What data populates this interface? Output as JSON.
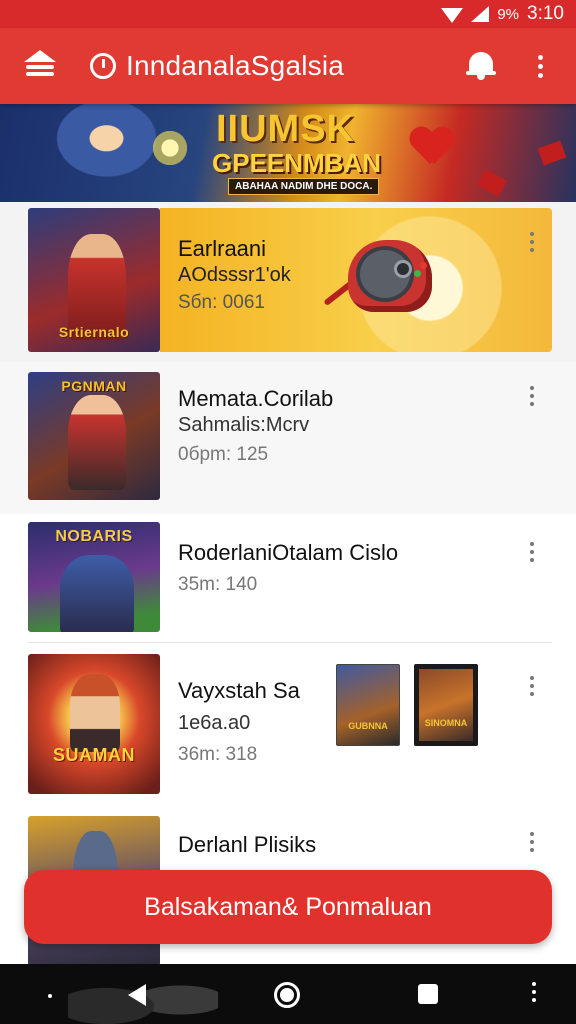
{
  "status_bar": {
    "battery": "9%",
    "time": "3:10"
  },
  "app_bar": {
    "title": "InndanalaSgalsia"
  },
  "banner": {
    "title": "IIUMSK",
    "subtitle": "GPEENMBAN",
    "tagline": "ABAHAA NADIM DHE DOCA."
  },
  "items": [
    {
      "title": "Earlraani",
      "subtitle": "AOdsssr1'ok",
      "meta": "Sбn: 0061",
      "thumb_logo": "Srtiernalo"
    },
    {
      "title": "Memata.Corilab",
      "subtitle": "Sahmalis:Mcrv",
      "meta": "0бpm: 125",
      "thumb_logo": "PGNMAN"
    },
    {
      "title": "RoderlaniOtalam Cislo",
      "meta": "35m: 140",
      "thumb_logo": "NOBARIS"
    },
    {
      "title": "Vayxstah Sa",
      "subtitle": "1e6a.a0",
      "meta": "36m: 318",
      "thumb_logo": "SUAMAN",
      "mini_labels": [
        "GUBNNA",
        "SINOMNA"
      ]
    },
    {
      "title": "Derlanl Plisiks"
    }
  ],
  "cta": {
    "label": "Balsakaman& Ponmaluan"
  },
  "colors": {
    "primary": "#e03a33",
    "status_bar": "#d92a2b",
    "cta": "#e0312d",
    "nav": "#0c0c0c"
  },
  "icons": [
    "wifi-icon",
    "signal-icon",
    "home-icon",
    "clock-icon",
    "bell-icon",
    "more-vert-icon",
    "gamepad-icon",
    "back-icon",
    "home-circle-icon",
    "recents-icon"
  ]
}
